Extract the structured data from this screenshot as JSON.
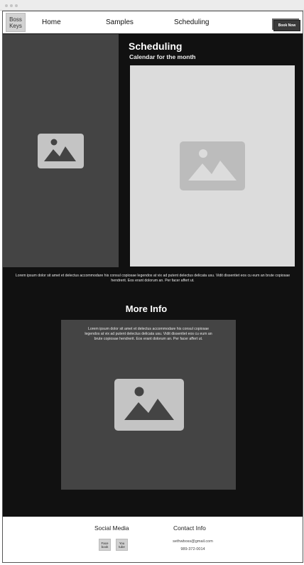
{
  "nav": {
    "logo_line1": "Boss",
    "logo_line2": "Keys",
    "links": [
      "Home",
      "Samples",
      "Scheduling"
    ],
    "book_button": "Book Now"
  },
  "scheduling": {
    "title": "Scheduling",
    "subtitle": "Calendar for the month"
  },
  "body_text": "Lorem ipsum dolor sit amet et delectus accommodare his consul copiosae legendos at vix ad putent delectus delicata usu. Vidit dissentiet eos cu eum an brute copiosae hendrerit. Eos erant dolorum an. Per facer affert ut.",
  "more_info": {
    "title": "More Info",
    "text": "Lorem ipsum dolor sit amet et delectus accommodare his consul copiosae legendos at vix ad putent delectus delicata usu. Vidit dissentiet eos cu eum an brute copiosae hendrerit. Eos erant dolorum an. Per facer affert ut."
  },
  "footer": {
    "social_heading": "Social Media",
    "contact_heading": "Contact Info",
    "facebook_line1": "Face",
    "facebook_line2": "book",
    "youtube_line1": "You",
    "youtube_line2": "tube",
    "email": "sethwboss@gmail.com",
    "phone": "989-372-0014"
  },
  "colors": {
    "page_background": "#111111",
    "panel_gray": "#444444",
    "calendar_gray": "#dcdcdc"
  }
}
